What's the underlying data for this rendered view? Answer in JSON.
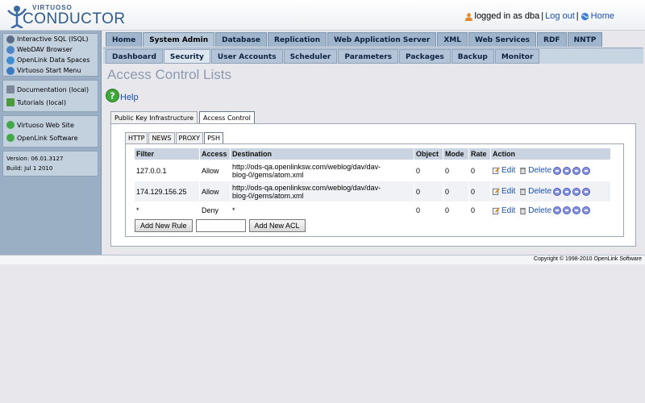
{
  "header": {
    "logo_top": "VIRTUOSO",
    "logo_main": "CONDUCTOR",
    "logged_in_text": "logged in as dba",
    "separator": "|",
    "logout": "Log out",
    "home": "Home"
  },
  "sidebar": {
    "group1": [
      "Interactive SQL (ISQL)",
      "WebDAV Browser",
      "OpenLink Data Spaces",
      "Virtuoso Start Menu"
    ],
    "group2": [
      "Documentation (local)",
      "Tutorials (local)"
    ],
    "group3": [
      "Virtuoso Web Site",
      "OpenLink Software"
    ],
    "version": "Version: 06.01.3127",
    "build": "Build: Jul 1 2010"
  },
  "menu_top": [
    "Home",
    "System Admin",
    "Database",
    "Replication",
    "Web Application Server",
    "XML",
    "Web Services",
    "RDF",
    "NNTP"
  ],
  "menu_sub": [
    "Dashboard",
    "Security",
    "User Accounts",
    "Scheduler",
    "Parameters",
    "Packages",
    "Backup",
    "Monitor"
  ],
  "page": {
    "title": "Access Control Lists",
    "help": "Help"
  },
  "outer_tabs": [
    "Public Key Infrastructure",
    "Access Control"
  ],
  "inner_tabs": [
    "HTTP",
    "NEWS",
    "PROXY",
    "PSH"
  ],
  "table": {
    "headers": [
      "Filter",
      "Access",
      "Destination",
      "Object",
      "Mode",
      "Rate",
      "Action"
    ],
    "rows": [
      {
        "filter": "127.0.0.1",
        "access": "Allow",
        "dest1": "http://ods-qa.openlinksw.com/weblog/dav/dav-",
        "dest2": "blog-0/gems/atom.xml",
        "object": "0",
        "mode": "0",
        "rate": "0"
      },
      {
        "filter": "174.129.156.25",
        "access": "Allow",
        "dest1": "http://ods-qa.openlinksw.com/weblog/dav/dav-",
        "dest2": "blog-0/gems/atom.xml",
        "object": "0",
        "mode": "0",
        "rate": "0"
      },
      {
        "filter": "*",
        "access": "Deny",
        "dest1": "*",
        "dest2": "",
        "object": "0",
        "mode": "0",
        "rate": "0"
      }
    ],
    "edit": "Edit",
    "delete": "Delete"
  },
  "buttons": {
    "add_rule": "Add New Rule",
    "add_acl": "Add New ACL"
  },
  "footer": "Copyright © 1998-2010 OpenLink Software"
}
